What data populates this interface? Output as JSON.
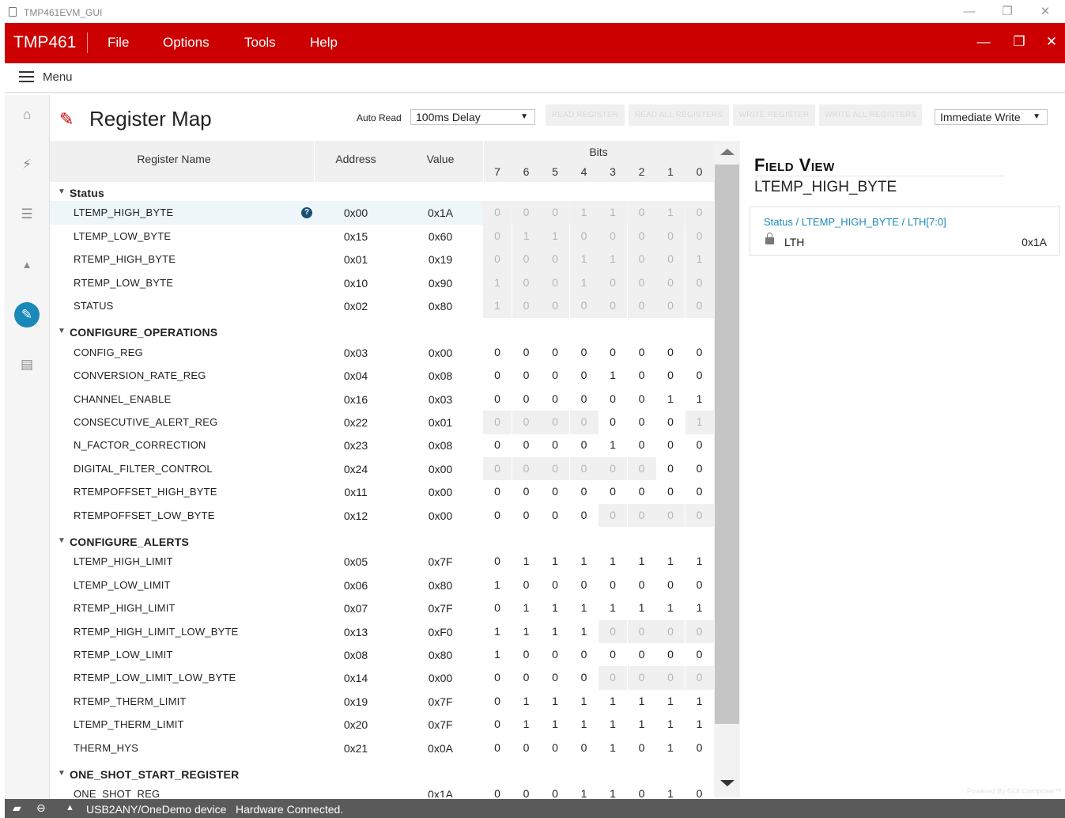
{
  "os_window": {
    "title": "TMP461EVM_GUI",
    "minimize": "—",
    "restore": "❐",
    "close": "✕"
  },
  "app_header": {
    "title": "TMP461",
    "menus": [
      "File",
      "Options",
      "Tools",
      "Help"
    ],
    "minimize": "—",
    "restore": "❐",
    "close": "✕"
  },
  "menu_strip": {
    "label": "Menu"
  },
  "nav": {
    "items": [
      {
        "icon": "home-icon",
        "glyph": "⌂"
      },
      {
        "icon": "lightning-icon",
        "glyph": "⚡"
      },
      {
        "icon": "sliders-icon",
        "glyph": "☰"
      },
      {
        "icon": "chart-icon",
        "glyph": "▲"
      },
      {
        "icon": "register-map-icon",
        "glyph": "✎",
        "active": true
      },
      {
        "icon": "log-icon",
        "glyph": "▤"
      }
    ]
  },
  "toolbar": {
    "title": "Register Map",
    "auto_read_label": "Auto Read",
    "auto_read_value": "100ms Delay",
    "buttons": [
      "READ REGISTER",
      "READ ALL REGISTERS",
      "WRITE REGISTER",
      "WRITE ALL REGISTERS"
    ],
    "write_mode_value": "Immediate Write"
  },
  "table": {
    "headers": {
      "name": "Register Name",
      "address": "Address",
      "value": "Value",
      "bits": "Bits"
    },
    "bit_labels": [
      "7",
      "6",
      "5",
      "4",
      "3",
      "2",
      "1",
      "0"
    ],
    "groups": [
      {
        "name": "Status",
        "registers": [
          {
            "name": "LTEMP_HIGH_BYTE",
            "address": "0x00",
            "value": "0x1A",
            "bits": [
              "0",
              "0",
              "0",
              "1",
              "1",
              "0",
              "1",
              "0"
            ],
            "ro": [
              1,
              1,
              1,
              1,
              1,
              1,
              1,
              1
            ],
            "selected": true
          },
          {
            "name": "LTEMP_LOW_BYTE",
            "address": "0x15",
            "value": "0x60",
            "bits": [
              "0",
              "1",
              "1",
              "0",
              "0",
              "0",
              "0",
              "0"
            ],
            "ro": [
              1,
              1,
              1,
              1,
              1,
              1,
              1,
              1
            ]
          },
          {
            "name": "RTEMP_HIGH_BYTE",
            "address": "0x01",
            "value": "0x19",
            "bits": [
              "0",
              "0",
              "0",
              "1",
              "1",
              "0",
              "0",
              "1"
            ],
            "ro": [
              1,
              1,
              1,
              1,
              1,
              1,
              1,
              1
            ]
          },
          {
            "name": "RTEMP_LOW_BYTE",
            "address": "0x10",
            "value": "0x90",
            "bits": [
              "1",
              "0",
              "0",
              "1",
              "0",
              "0",
              "0",
              "0"
            ],
            "ro": [
              1,
              1,
              1,
              1,
              1,
              1,
              1,
              1
            ]
          },
          {
            "name": "STATUS",
            "address": "0x02",
            "value": "0x80",
            "bits": [
              "1",
              "0",
              "0",
              "0",
              "0",
              "0",
              "0",
              "0"
            ],
            "ro": [
              1,
              1,
              1,
              1,
              1,
              1,
              1,
              1
            ]
          }
        ]
      },
      {
        "name": "CONFIGURE_OPERATIONS",
        "registers": [
          {
            "name": "CONFIG_REG",
            "address": "0x03",
            "value": "0x00",
            "bits": [
              "0",
              "0",
              "0",
              "0",
              "0",
              "0",
              "0",
              "0"
            ],
            "ro": [
              0,
              0,
              0,
              0,
              0,
              0,
              0,
              0
            ]
          },
          {
            "name": "CONVERSION_RATE_REG",
            "address": "0x04",
            "value": "0x08",
            "bits": [
              "0",
              "0",
              "0",
              "0",
              "1",
              "0",
              "0",
              "0"
            ],
            "ro": [
              0,
              0,
              0,
              0,
              0,
              0,
              0,
              0
            ]
          },
          {
            "name": "CHANNEL_ENABLE",
            "address": "0x16",
            "value": "0x03",
            "bits": [
              "0",
              "0",
              "0",
              "0",
              "0",
              "0",
              "1",
              "1"
            ],
            "ro": [
              0,
              0,
              0,
              0,
              0,
              0,
              0,
              0
            ]
          },
          {
            "name": "CONSECUTIVE_ALERT_REG",
            "address": "0x22",
            "value": "0x01",
            "bits": [
              "0",
              "0",
              "0",
              "0",
              "0",
              "0",
              "0",
              "1"
            ],
            "ro": [
              1,
              1,
              1,
              1,
              0,
              0,
              0,
              1
            ]
          },
          {
            "name": "N_FACTOR_CORRECTION",
            "address": "0x23",
            "value": "0x08",
            "bits": [
              "0",
              "0",
              "0",
              "0",
              "1",
              "0",
              "0",
              "0"
            ],
            "ro": [
              0,
              0,
              0,
              0,
              0,
              0,
              0,
              0
            ]
          },
          {
            "name": "DIGITAL_FILTER_CONTROL",
            "address": "0x24",
            "value": "0x00",
            "bits": [
              "0",
              "0",
              "0",
              "0",
              "0",
              "0",
              "0",
              "0"
            ],
            "ro": [
              1,
              1,
              1,
              1,
              1,
              1,
              0,
              0
            ]
          },
          {
            "name": "RTEMPOFFSET_HIGH_BYTE",
            "address": "0x11",
            "value": "0x00",
            "bits": [
              "0",
              "0",
              "0",
              "0",
              "0",
              "0",
              "0",
              "0"
            ],
            "ro": [
              0,
              0,
              0,
              0,
              0,
              0,
              0,
              0
            ]
          },
          {
            "name": "RTEMPOFFSET_LOW_BYTE",
            "address": "0x12",
            "value": "0x00",
            "bits": [
              "0",
              "0",
              "0",
              "0",
              "0",
              "0",
              "0",
              "0"
            ],
            "ro": [
              0,
              0,
              0,
              0,
              1,
              1,
              1,
              1
            ]
          }
        ]
      },
      {
        "name": "CONFIGURE_ALERTS",
        "registers": [
          {
            "name": "LTEMP_HIGH_LIMIT",
            "address": "0x05",
            "value": "0x7F",
            "bits": [
              "0",
              "1",
              "1",
              "1",
              "1",
              "1",
              "1",
              "1"
            ],
            "ro": [
              0,
              0,
              0,
              0,
              0,
              0,
              0,
              0
            ]
          },
          {
            "name": "LTEMP_LOW_LIMIT",
            "address": "0x06",
            "value": "0x80",
            "bits": [
              "1",
              "0",
              "0",
              "0",
              "0",
              "0",
              "0",
              "0"
            ],
            "ro": [
              0,
              0,
              0,
              0,
              0,
              0,
              0,
              0
            ]
          },
          {
            "name": "RTEMP_HIGH_LIMIT",
            "address": "0x07",
            "value": "0x7F",
            "bits": [
              "0",
              "1",
              "1",
              "1",
              "1",
              "1",
              "1",
              "1"
            ],
            "ro": [
              0,
              0,
              0,
              0,
              0,
              0,
              0,
              0
            ]
          },
          {
            "name": "RTEMP_HIGH_LIMIT_LOW_BYTE",
            "address": "0x13",
            "value": "0xF0",
            "bits": [
              "1",
              "1",
              "1",
              "1",
              "0",
              "0",
              "0",
              "0"
            ],
            "ro": [
              0,
              0,
              0,
              0,
              1,
              1,
              1,
              1
            ]
          },
          {
            "name": "RTEMP_LOW_LIMIT",
            "address": "0x08",
            "value": "0x80",
            "bits": [
              "1",
              "0",
              "0",
              "0",
              "0",
              "0",
              "0",
              "0"
            ],
            "ro": [
              0,
              0,
              0,
              0,
              0,
              0,
              0,
              0
            ]
          },
          {
            "name": "RTEMP_LOW_LIMIT_LOW_BYTE",
            "address": "0x14",
            "value": "0x00",
            "bits": [
              "0",
              "0",
              "0",
              "0",
              "0",
              "0",
              "0",
              "0"
            ],
            "ro": [
              0,
              0,
              0,
              0,
              1,
              1,
              1,
              1
            ]
          },
          {
            "name": "RTEMP_THERM_LIMIT",
            "address": "0x19",
            "value": "0x7F",
            "bits": [
              "0",
              "1",
              "1",
              "1",
              "1",
              "1",
              "1",
              "1"
            ],
            "ro": [
              0,
              0,
              0,
              0,
              0,
              0,
              0,
              0
            ]
          },
          {
            "name": "LTEMP_THERM_LIMIT",
            "address": "0x20",
            "value": "0x7F",
            "bits": [
              "0",
              "1",
              "1",
              "1",
              "1",
              "1",
              "1",
              "1"
            ],
            "ro": [
              0,
              0,
              0,
              0,
              0,
              0,
              0,
              0
            ]
          },
          {
            "name": "THERM_HYS",
            "address": "0x21",
            "value": "0x0A",
            "bits": [
              "0",
              "0",
              "0",
              "0",
              "1",
              "0",
              "1",
              "0"
            ],
            "ro": [
              0,
              0,
              0,
              0,
              0,
              0,
              0,
              0
            ]
          }
        ]
      },
      {
        "name": "ONE_SHOT_START_REGISTER",
        "registers": [
          {
            "name": "ONE_SHOT_REG",
            "address": "",
            "value": "0x1A",
            "bits": [
              "0",
              "0",
              "0",
              "1",
              "1",
              "0",
              "1",
              "0"
            ],
            "ro": [
              0,
              0,
              0,
              0,
              0,
              0,
              0,
              0
            ]
          }
        ]
      }
    ]
  },
  "field_view": {
    "title": "Field View",
    "register": "LTEMP_HIGH_BYTE",
    "path": "Status / LTEMP_HIGH_BYTE / LTH[7:0]",
    "field_name": "LTH",
    "field_value": "0x1A",
    "powered_by": "Powered By GUI Composer™"
  },
  "status_bar": {
    "device": "USB2ANY/OneDemo device",
    "connection": "Hardware Connected."
  },
  "colors": {
    "header_red": "#cc0000",
    "accent_blue": "#1a88b8",
    "status_bar": "#5a5a5a"
  }
}
